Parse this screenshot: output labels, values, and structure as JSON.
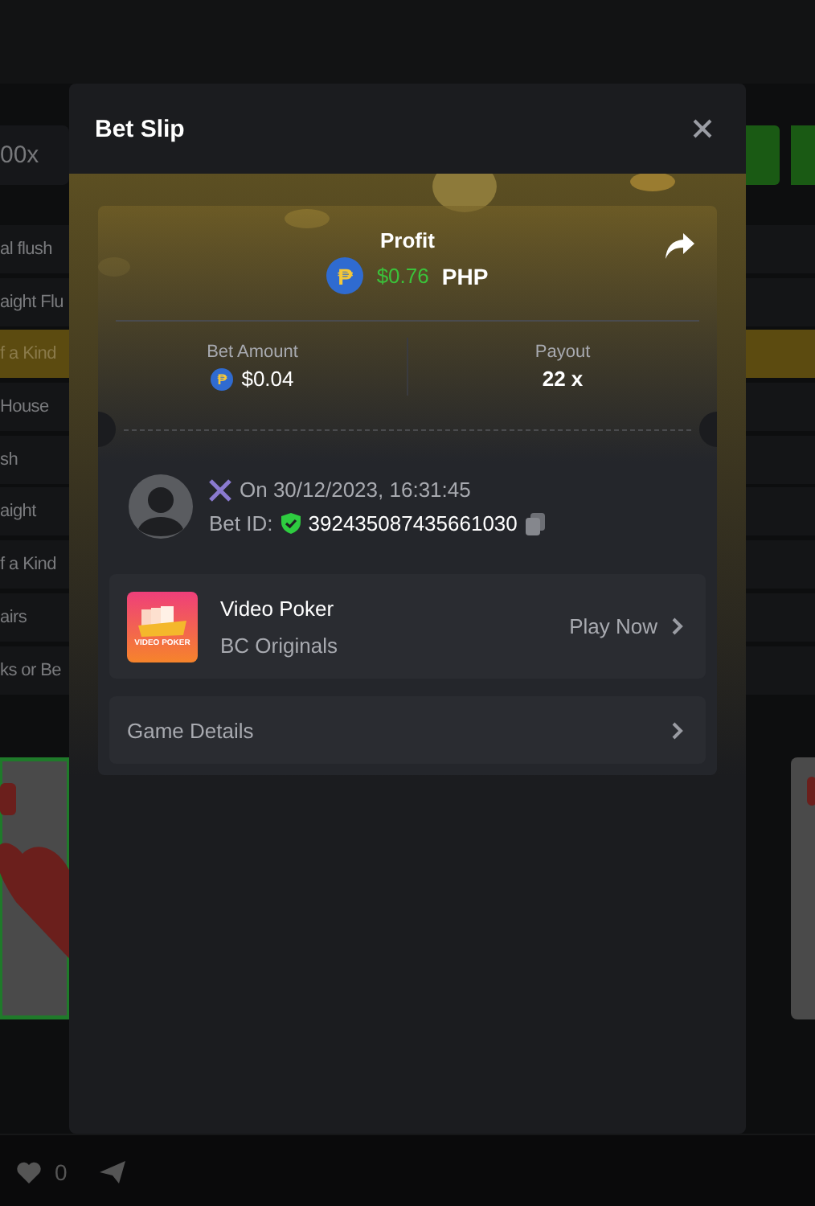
{
  "background": {
    "multiplier_field": {
      "value": "00x"
    },
    "paytable": [
      {
        "label": "al flush",
        "selected": false
      },
      {
        "label": "aight Flu",
        "selected": false
      },
      {
        "label": "f a Kind",
        "selected": true
      },
      {
        "label": "House",
        "selected": false
      },
      {
        "label": "sh",
        "selected": false
      },
      {
        "label": "aight",
        "selected": false
      },
      {
        "label": "f a Kind",
        "selected": false
      },
      {
        "label": "airs",
        "selected": false
      },
      {
        "label": "ks or Be",
        "selected": false
      }
    ],
    "likes": "0"
  },
  "modal": {
    "title": "Bet Slip",
    "profit": {
      "label": "Profit",
      "coin_symbol": "₱",
      "amount": "$0.76",
      "currency": "PHP"
    },
    "bet_amount": {
      "label": "Bet Amount",
      "coin_symbol": "₱",
      "value": "$0.04"
    },
    "payout": {
      "label": "Payout",
      "value": "22 x"
    },
    "date": "On 30/12/2023, 16:31:45",
    "bet_id": {
      "label": "Bet ID:",
      "value": "392435087435661030"
    },
    "game": {
      "name": "Video Poker",
      "provider": "BC Originals",
      "action": "Play Now",
      "logo_text": "VIDEO POKER"
    },
    "details": "Game Details"
  }
}
